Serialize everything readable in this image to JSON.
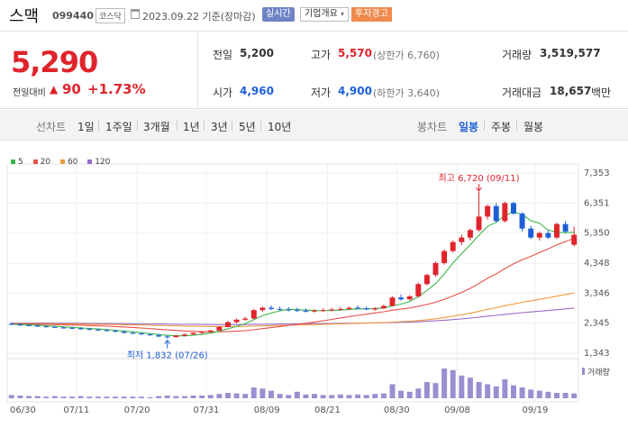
{
  "header": {
    "name": "스맥",
    "code": "099440",
    "market": "코스닥",
    "date": "2023.09.22  기준(장마감)",
    "realtime_btn": "실시간",
    "company_btn": "기업개요",
    "warning_btn": "투자경고"
  },
  "price": {
    "current": "5,290",
    "change_label": "전일대비",
    "change_value": "90",
    "change_pct": "+1.73%",
    "prev_label": "전일",
    "prev_value": "5,200",
    "high_label": "고가",
    "high_value": "5,570",
    "upper_limit": "(상한가 6,760)",
    "volume_label": "거래량",
    "volume_value": "3,519,577",
    "open_label": "시가",
    "open_value": "4,960",
    "low_label": "저가",
    "low_value": "4,900",
    "lower_limit": "(하한가 3,640)",
    "amount_label": "거래대금",
    "amount_value": "18,657",
    "amount_unit": "백만"
  },
  "periods": {
    "line_label": "선차트",
    "items": [
      "1일",
      "1주일",
      "3개월",
      "1년",
      "3년",
      "5년",
      "10년"
    ],
    "candle_label": "봉차트",
    "candle_items": [
      "일봉",
      "주봉",
      "월봉"
    ],
    "active_candle": "일봉"
  },
  "colors": {
    "up": "#e0242c",
    "down": "#1e5fd8",
    "ma5": "#3bb54a",
    "ma20": "#e8504a",
    "ma60": "#f09a3e",
    "ma120": "#9a6bc8",
    "volume": "#9b8ed0"
  },
  "chart_data": {
    "type": "candlestick",
    "legend": [
      "5",
      "20",
      "60",
      "120"
    ],
    "y_ticks": [
      "7,353",
      "6,351",
      "5,350",
      "4,348",
      "3,346",
      "2,345",
      "1,343"
    ],
    "ylim": [
      1343,
      7353
    ],
    "x_ticks": [
      "06/30",
      "07/11",
      "07/20",
      "07/31",
      "08/09",
      "08/21",
      "08/30",
      "09/08",
      "09/19"
    ],
    "high_annotation": "최고 6,720 (09/11)",
    "low_annotation": "최저 1,832 (07/26)",
    "volume_label": "거래량",
    "candles": [
      [
        2320,
        2380,
        2280,
        2300
      ],
      [
        2300,
        2340,
        2250,
        2280
      ],
      [
        2280,
        2320,
        2240,
        2260
      ],
      [
        2260,
        2300,
        2220,
        2240
      ],
      [
        2240,
        2280,
        2200,
        2220
      ],
      [
        2220,
        2260,
        2190,
        2200
      ],
      [
        2200,
        2240,
        2170,
        2190
      ],
      [
        2190,
        2230,
        2150,
        2170
      ],
      [
        2170,
        2210,
        2130,
        2150
      ],
      [
        2150,
        2190,
        2110,
        2130
      ],
      [
        2130,
        2170,
        2090,
        2110
      ],
      [
        2110,
        2150,
        2070,
        2090
      ],
      [
        2090,
        2130,
        2040,
        2060
      ],
      [
        2060,
        2100,
        2000,
        2020
      ],
      [
        2020,
        2060,
        1980,
        2000
      ],
      [
        2000,
        2040,
        1950,
        1970
      ],
      [
        1970,
        2010,
        1920,
        1940
      ],
      [
        1940,
        1990,
        1880,
        1900
      ],
      [
        1900,
        1950,
        1832,
        1880
      ],
      [
        1880,
        1960,
        1860,
        1930
      ],
      [
        1930,
        2000,
        1900,
        1970
      ],
      [
        1970,
        2040,
        1950,
        2020
      ],
      [
        2020,
        2080,
        1990,
        2050
      ],
      [
        2050,
        2120,
        2030,
        2100
      ],
      [
        2100,
        2250,
        2080,
        2220
      ],
      [
        2220,
        2420,
        2200,
        2380
      ],
      [
        2380,
        2500,
        2340,
        2460
      ],
      [
        2460,
        2560,
        2420,
        2500
      ],
      [
        2500,
        2820,
        2480,
        2780
      ],
      [
        2780,
        2900,
        2720,
        2860
      ],
      [
        2860,
        2940,
        2780,
        2820
      ],
      [
        2820,
        2900,
        2760,
        2800
      ],
      [
        2800,
        2880,
        2740,
        2780
      ],
      [
        2780,
        2860,
        2720,
        2760
      ],
      [
        2760,
        2840,
        2700,
        2740
      ],
      [
        2740,
        2820,
        2700,
        2760
      ],
      [
        2760,
        2840,
        2720,
        2780
      ],
      [
        2780,
        2860,
        2740,
        2800
      ],
      [
        2800,
        2880,
        2760,
        2820
      ],
      [
        2820,
        2900,
        2780,
        2860
      ],
      [
        2860,
        2940,
        2800,
        2840
      ],
      [
        2840,
        2900,
        2780,
        2800
      ],
      [
        2800,
        2880,
        2760,
        2840
      ],
      [
        2840,
        2960,
        2820,
        2920
      ],
      [
        2920,
        3240,
        2900,
        3200
      ],
      [
        3200,
        3300,
        3100,
        3140
      ],
      [
        3140,
        3280,
        3100,
        3240
      ],
      [
        3240,
        3700,
        3200,
        3650
      ],
      [
        3650,
        4000,
        3600,
        3950
      ],
      [
        3950,
        4400,
        3900,
        4350
      ],
      [
        4350,
        4800,
        4300,
        4750
      ],
      [
        4750,
        5100,
        4700,
        5050
      ],
      [
        5050,
        5300,
        4950,
        5200
      ],
      [
        5200,
        5500,
        5100,
        5450
      ],
      [
        5450,
        6720,
        5400,
        5900
      ],
      [
        5900,
        6300,
        5800,
        6250
      ],
      [
        6250,
        6350,
        5700,
        5750
      ],
      [
        5750,
        6400,
        5700,
        6350
      ],
      [
        6350,
        6400,
        5950,
        6000
      ],
      [
        6000,
        6050,
        5400,
        5500
      ],
      [
        5500,
        5600,
        5150,
        5200
      ],
      [
        5200,
        5400,
        5100,
        5350
      ],
      [
        5350,
        5450,
        5150,
        5200
      ],
      [
        5200,
        5700,
        5150,
        5650
      ],
      [
        5650,
        5750,
        5350,
        5400
      ],
      [
        4960,
        5570,
        4900,
        5290
      ]
    ],
    "volumes": [
      6,
      5,
      4,
      4,
      3,
      4,
      3,
      3,
      4,
      3,
      3,
      3,
      3,
      3,
      3,
      3,
      2,
      4,
      5,
      4,
      4,
      5,
      5,
      6,
      8,
      10,
      9,
      8,
      20,
      18,
      14,
      8,
      6,
      12,
      7,
      8,
      6,
      6,
      7,
      6,
      7,
      6,
      8,
      9,
      26,
      14,
      12,
      18,
      30,
      28,
      55,
      52,
      42,
      38,
      30,
      26,
      22,
      35,
      24,
      20,
      16,
      14,
      12,
      10,
      10,
      9
    ],
    "volume_max": 60
  }
}
